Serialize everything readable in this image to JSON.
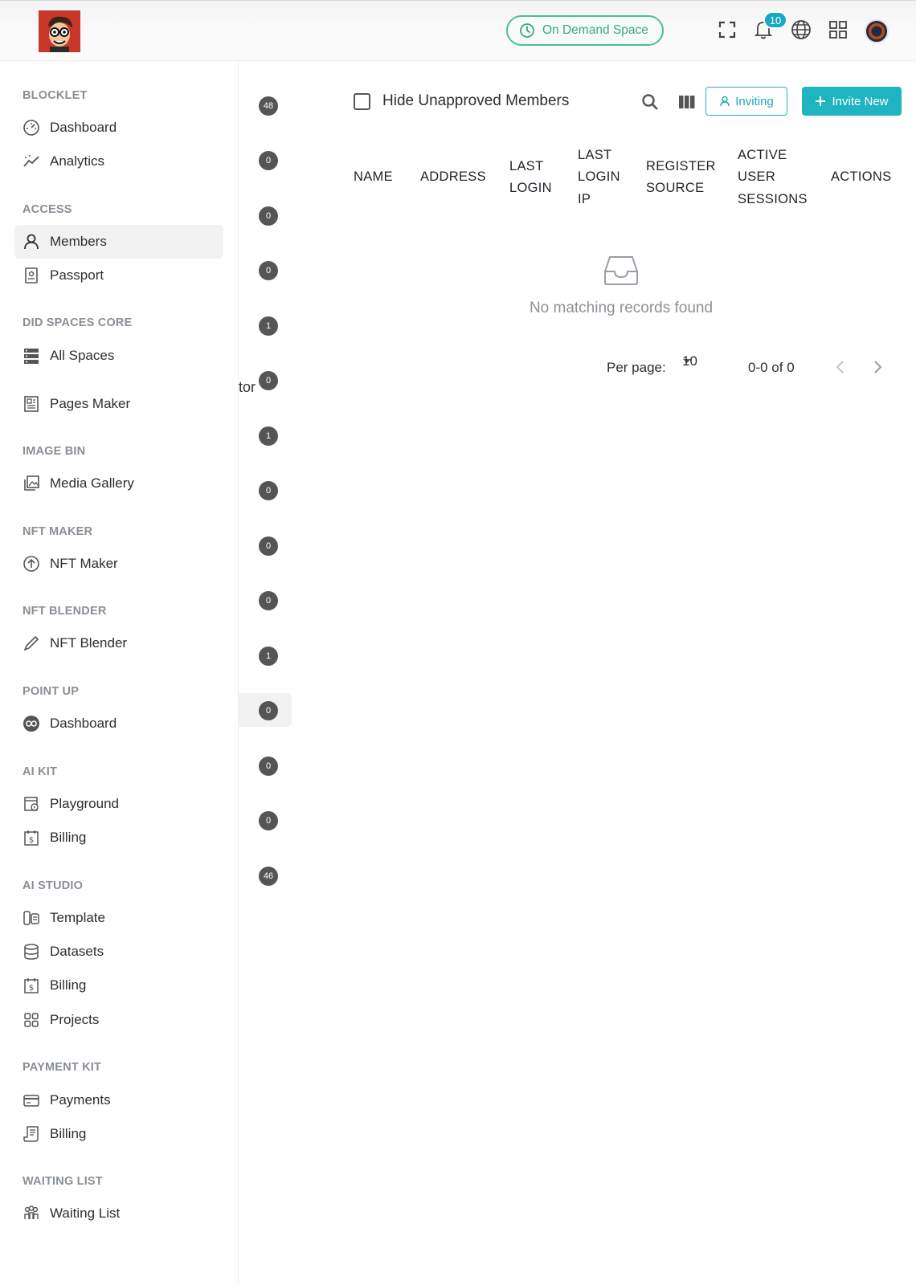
{
  "topbar": {
    "space_label": "On Demand Space",
    "notification_count": "10",
    "icons": [
      "fullscreen-icon",
      "bell-icon",
      "globe-icon",
      "apps-grid-icon",
      "avatar"
    ]
  },
  "sidebar": {
    "sections": [
      {
        "title": "BLOCKLET",
        "items": [
          {
            "label": "Dashboard",
            "icon": "dashboard-icon"
          },
          {
            "label": "Analytics",
            "icon": "analytics-icon"
          }
        ]
      },
      {
        "title": "ACCESS",
        "items": [
          {
            "label": "Members",
            "icon": "user-icon",
            "active": true
          },
          {
            "label": "Passport",
            "icon": "passport-icon"
          }
        ]
      },
      {
        "title": "DID SPACES CORE",
        "items": [
          {
            "label": "All Spaces",
            "icon": "storage-icon"
          },
          {
            "label": "Pages Maker",
            "icon": "pages-icon"
          }
        ]
      },
      {
        "title": "IMAGE BIN",
        "items": [
          {
            "label": "Media Gallery",
            "icon": "gallery-icon"
          }
        ]
      },
      {
        "title": "NFT MAKER",
        "items": [
          {
            "label": "NFT Maker",
            "icon": "upload-circle-icon"
          }
        ]
      },
      {
        "title": "NFT BLENDER",
        "items": [
          {
            "label": "NFT Blender",
            "icon": "pen-icon"
          }
        ]
      },
      {
        "title": "POINT UP",
        "items": [
          {
            "label": "Dashboard",
            "icon": "infinity-icon"
          }
        ]
      },
      {
        "title": "AI KIT",
        "items": [
          {
            "label": "Playground",
            "icon": "playground-icon"
          },
          {
            "label": "Billing",
            "icon": "billing-icon"
          }
        ]
      },
      {
        "title": "AI STUDIO",
        "items": [
          {
            "label": "Template",
            "icon": "template-icon"
          },
          {
            "label": "Datasets",
            "icon": "database-icon"
          },
          {
            "label": "Billing",
            "icon": "billing-icon"
          },
          {
            "label": "Projects",
            "icon": "projects-icon"
          }
        ]
      },
      {
        "title": "PAYMENT KIT",
        "items": [
          {
            "label": "Payments",
            "icon": "card-icon"
          },
          {
            "label": "Billing",
            "icon": "receipt-icon"
          }
        ]
      },
      {
        "title": "WAITING LIST",
        "items": [
          {
            "label": "Waiting List",
            "icon": "people-icon"
          }
        ]
      }
    ]
  },
  "role_counts": [
    "48",
    "0",
    "0",
    "0",
    "1",
    "0",
    "1",
    "0",
    "0",
    "0",
    "1",
    "0",
    "0",
    "0",
    "46"
  ],
  "clipped_text": "tor",
  "toolbar": {
    "hide_unapproved_label": "Hide Unapproved Members",
    "inviting_label": "Inviting",
    "invite_new_label": "Invite New"
  },
  "table": {
    "columns": [
      "NAME",
      "ADDRESS",
      "LAST LOGIN",
      "LAST LOGIN IP",
      "REGISTER SOURCE",
      "ACTIVE USER SESSIONS",
      "ACTIONS"
    ],
    "empty_message": "No matching records found"
  },
  "pagination": {
    "per_page_label": "Per page:",
    "per_page_value": "10",
    "range": "0-0 of 0"
  },
  "colors": {
    "accent": "#1fb5c0",
    "space_green": "#4dbd9a",
    "badge": "#18a9c5"
  }
}
